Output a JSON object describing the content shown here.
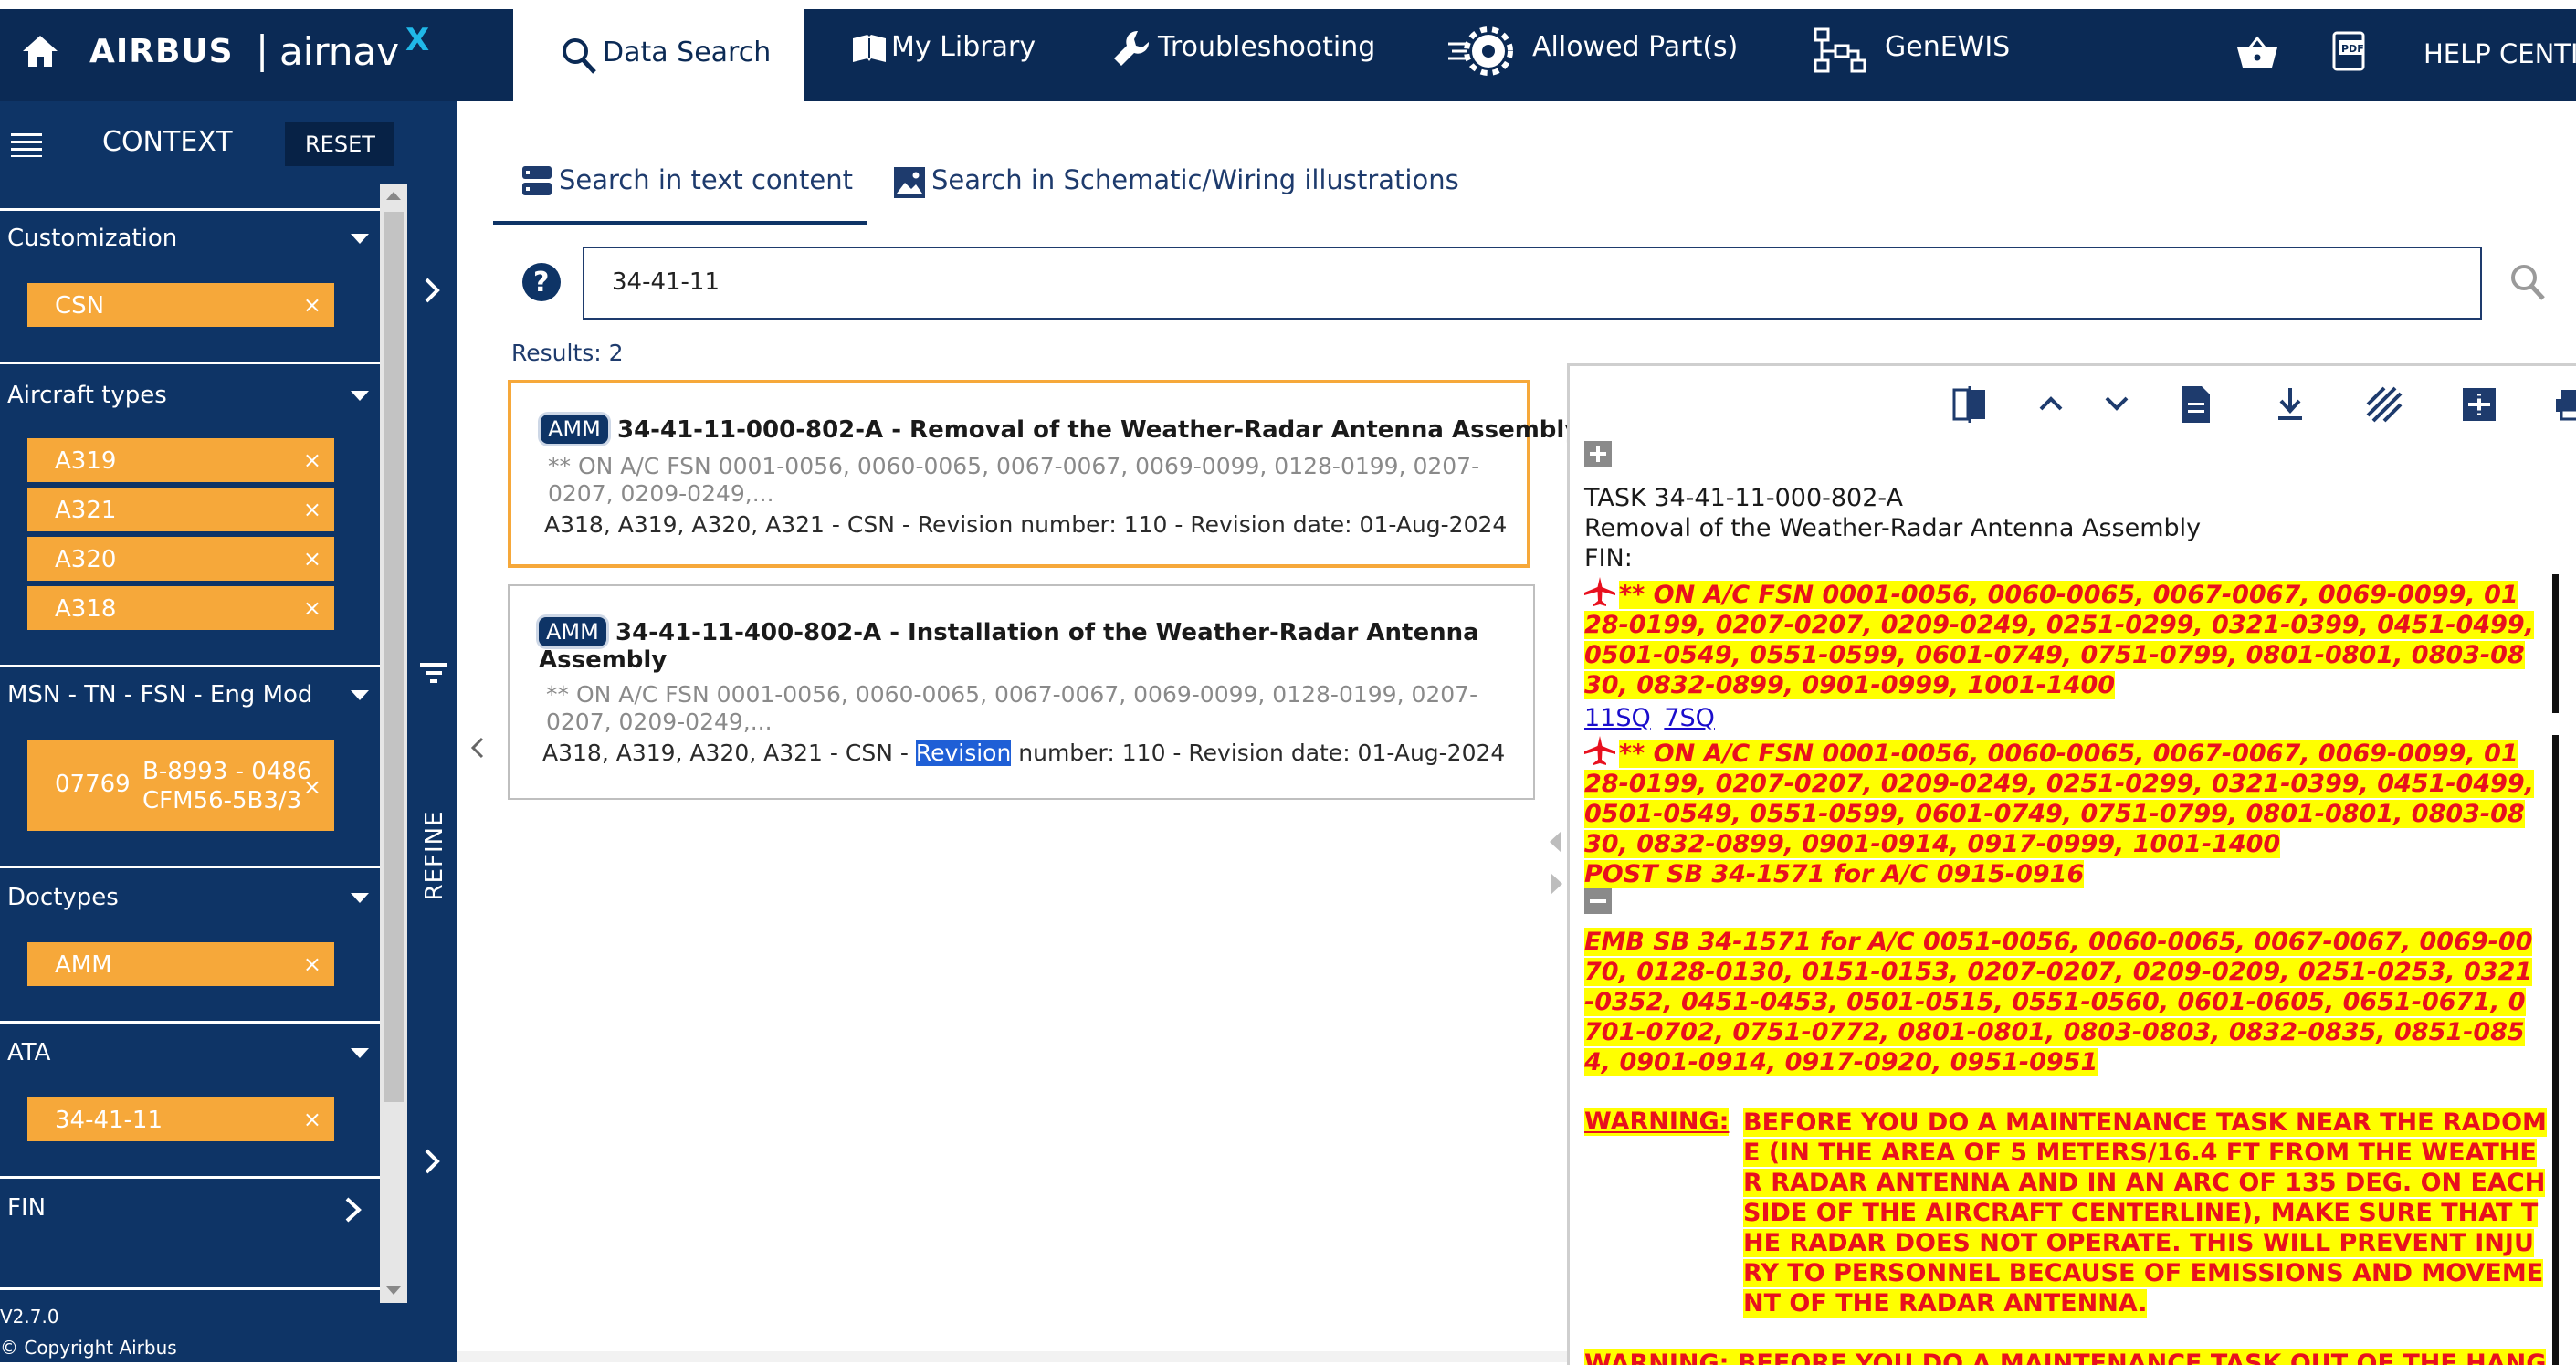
{
  "header": {
    "brand": "AIRBUS",
    "product": "airnav",
    "product_super": "X",
    "separator": "|",
    "tabs": [
      "Data Search",
      "My Library",
      "Troubleshooting",
      "Allowed Part(s)",
      "GenEWIS"
    ],
    "help": "HELP CENTI"
  },
  "sidebar": {
    "context_label": "CONTEXT",
    "reset_label": "RESET",
    "sections": {
      "customization": {
        "title": "Customization",
        "chips": [
          "CSN"
        ]
      },
      "aircraft_types": {
        "title": "Aircraft types",
        "chips": [
          "A319",
          "A321",
          "A320",
          "A318"
        ]
      },
      "msn": {
        "title": "MSN - TN - FSN - Eng Mod",
        "chip_id": "07769",
        "chip_line1": "B-8993 - 0486",
        "chip_line2": "CFM56-5B3/3"
      },
      "doctypes": {
        "title": "Doctypes",
        "chips": [
          "AMM"
        ]
      },
      "ata": {
        "title": "ATA",
        "chips": [
          "34-41-11"
        ]
      },
      "fin": {
        "title": "FIN"
      }
    },
    "chip_close": "×",
    "version": "V2.7.0",
    "copyright": "© Copyright Airbus",
    "refine_label": "REFINE"
  },
  "search": {
    "tab_text": "Search in text content",
    "tab_schematic": "Search in Schematic/Wiring illustrations",
    "help_glyph": "?",
    "query": "34-41-11",
    "results_label": "Results: 2"
  },
  "results": [
    {
      "badge": "AMM",
      "title": "34-41-11-000-802-A - Removal of the Weather-Radar Antenna Assembly",
      "sub1": "** ON A/C FSN 0001-0056, 0060-0065, 0067-0067, 0069-0099, 0128-0199, 0207-",
      "sub2": "0207, 0209-0249,...",
      "line_pre": "A318, A319, A320, A321 - CSN - Revision number: 110 - Revision date: 01-Aug-2024"
    },
    {
      "badge": "AMM",
      "title1": "34-41-11-400-802-A - Installation of the Weather-Radar Antenna",
      "title2": "Assembly",
      "sub1": "** ON A/C FSN 0001-0056, 0060-0065, 0067-0067, 0069-0099, 0128-0199, 0207-",
      "sub2": "0207, 0209-0249,...",
      "line_pre": "A318, A319, A320, A321 - CSN - ",
      "line_hl": "Revision",
      "line_post": " number: 110 - Revision date: 01-Aug-2024"
    }
  ],
  "doc": {
    "task": "TASK 34-41-11-000-802-A",
    "title": "Removal of the Weather-Radar Antenna Assembly",
    "fin": "FIN:",
    "block1": [
      "** ON A/C FSN 0001-0056, 0060-0065, 0067-0067, 0069-0099, 01",
      "28-0199, 0207-0207, 0209-0249, 0251-0299, 0321-0399, 0451-0499,",
      "0501-0549, 0551-0599, 0601-0749, 0751-0799, 0801-0801, 0803-08",
      "30, 0832-0899, 0901-0999, 1001-1400"
    ],
    "link1": "11SQ",
    "link2": "7SQ",
    "block2": [
      "** ON A/C FSN 0001-0056, 0060-0065, 0067-0067, 0069-0099, 01",
      "28-0199, 0207-0207, 0209-0249, 0251-0299, 0321-0399, 0451-0499,",
      "0501-0549, 0551-0599, 0601-0749, 0751-0799, 0801-0801, 0803-08",
      "30, 0832-0899, 0901-0914, 0917-0999, 1001-1400",
      "POST SB 34-1571 for A/C 0915-0916"
    ],
    "block3": [
      "EMB SB 34-1571 for A/C 0051-0056, 0060-0065, 0067-0067, 0069-00",
      "70, 0128-0130, 0151-0153, 0207-0207, 0209-0209, 0251-0253, 0321",
      "-0352, 0451-0453, 0501-0515, 0551-0560, 0601-0605, 0651-0671, 0",
      "701-0702, 0751-0772, 0801-0801, 0803-0803, 0832-0835, 0851-085",
      "4, 0901-0914, 0917-0920, 0951-0951"
    ],
    "warning_label": "WARNING:",
    "warning": [
      "BEFORE YOU DO A MAINTENANCE TASK NEAR THE RADOM",
      "E (IN THE AREA OF 5 METERS/16.4 FT FROM THE WEATHE",
      "R RADAR ANTENNA AND IN AN ARC OF 135 DEG. ON EACH",
      "SIDE OF THE AIRCRAFT CENTERLINE), MAKE SURE THAT T",
      "HE RADAR DOES NOT OPERATE. THIS WILL PREVENT INJU",
      "RY TO PERSONNEL BECAUSE OF EMISSIONS AND MOVEME",
      "NT OF THE RADAR ANTENNA."
    ],
    "warning2_cut": "WARNING: BEFORE YOU DO A MAINTENANCE TASK OUT OF THE HANG"
  },
  "colors": {
    "nav": "#0b2a55",
    "sidebar": "#0e3466",
    "chip": "#f6a83a",
    "highlight": "#ffff00",
    "alert_red": "#e8101e",
    "accent_border": "#f6a83a"
  }
}
